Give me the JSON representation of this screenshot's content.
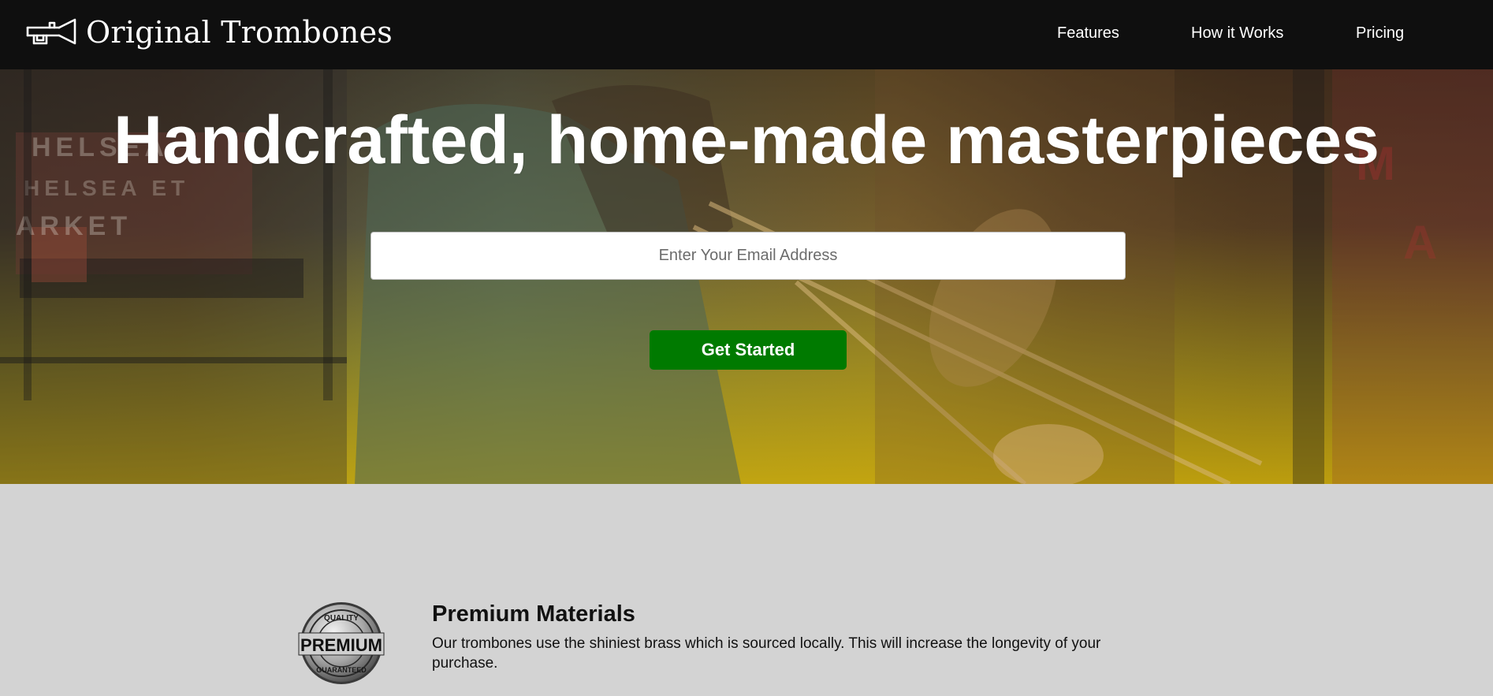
{
  "brand": {
    "name": "Original Trombones",
    "logo_icon": "trombone-icon"
  },
  "nav": {
    "items": [
      {
        "label": "Features"
      },
      {
        "label": "How it Works"
      },
      {
        "label": "Pricing"
      }
    ]
  },
  "hero": {
    "title": "Handcrafted, home-made masterpieces",
    "email_placeholder": "Enter Your Email Address",
    "email_value": "",
    "cta_label": "Get Started",
    "background_image": "musician-playing-trombone-photo",
    "cta_color": "#007a00"
  },
  "features": {
    "items": [
      {
        "icon": "premium-quality-badge",
        "title": "Premium Materials",
        "description": "Our trombones use the shiniest brass which is sourced locally. This will increase the longevity of your purchase.",
        "badge_text": {
          "top": "QUALITY",
          "middle": "PREMIUM",
          "bottom": "GUARANTEED"
        }
      }
    ]
  },
  "colors": {
    "navbar": "#0f0f0f",
    "features_bg": "#d3d3d3",
    "button": "#007a00"
  }
}
